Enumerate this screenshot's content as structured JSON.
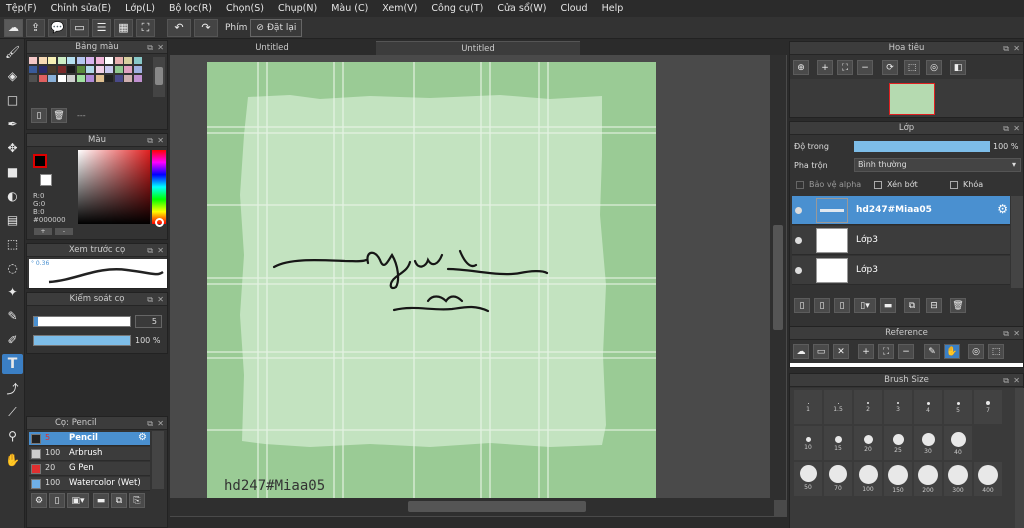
{
  "menu": [
    "Tệp(F)",
    "Chỉnh sửa(E)",
    "Lớp(L)",
    "Bộ lọc(R)",
    "Chọn(S)",
    "Chụp(N)",
    "Màu (C)",
    "Xem(V)",
    "Công cụ(T)",
    "Cửa sổ(W)",
    "Cloud",
    "Help"
  ],
  "toolbar": {
    "brush_label": "Phím",
    "reset_label": "Đặt lại"
  },
  "panels": {
    "palette": "Bảng màu",
    "palette_dash": "---",
    "color": "Màu",
    "brush_preview": "Xem trước cọ",
    "brush_control": "Kiểm soát cọ",
    "brush_list": "Cọ: Pencil",
    "navigator": "Hoa tiêu",
    "layer": "Lớp",
    "reference": "Reference",
    "brush_size": "Brush Size"
  },
  "color": {
    "r": "R:0",
    "g": "G:0",
    "b": "B:0",
    "hex": "#000000",
    "current": "#000000"
  },
  "brush_preview_size": "0.36",
  "brush_control": {
    "size": "5",
    "opacity": "100 %",
    "opacity_pct": 100
  },
  "brushes": [
    {
      "size": "5",
      "name": "Pencil",
      "color": "#222",
      "selected": true
    },
    {
      "size": "100",
      "name": "Arbrush",
      "color": "#ccc",
      "selected": false
    },
    {
      "size": "20",
      "name": "G Pen",
      "color": "#e03030",
      "selected": false
    },
    {
      "size": "100",
      "name": "Watercolor (Wet)",
      "color": "#6fb0e8",
      "selected": false
    }
  ],
  "tabs": [
    "Untitled",
    "Untitled"
  ],
  "canvas": {
    "script_main": "Ngủ",
    "script_side": "đi",
    "script_sub": "cưng",
    "watermark": "hd247#Miaa05"
  },
  "layer": {
    "opacity_label": "Độ trong",
    "opacity_value": "100 %",
    "blend_label": "Pha trộn",
    "blend_value": "Bình thường",
    "alpha_protect": "Bảo vệ alpha",
    "clipping": "Xén bớt",
    "lock": "Khóa",
    "layers": [
      {
        "name": "hd247#Miaa05",
        "selected": true
      },
      {
        "name": "Lớp3",
        "selected": false
      },
      {
        "name": "Lớp3",
        "selected": false
      }
    ]
  },
  "brush_sizes": [
    [
      "1",
      "1.5",
      "2",
      "3",
      "4",
      "5",
      "7"
    ],
    [
      "10",
      "15",
      "20",
      "25",
      "30",
      "40"
    ],
    [
      "50",
      "70",
      "100",
      "150",
      "200",
      "300",
      "400"
    ]
  ],
  "colors": {
    "accent": "#3b7fc4",
    "canvas_bg": "#c3e3c0",
    "canvas_border": "#9acb95",
    "selected_layer": "#4a90d0"
  }
}
